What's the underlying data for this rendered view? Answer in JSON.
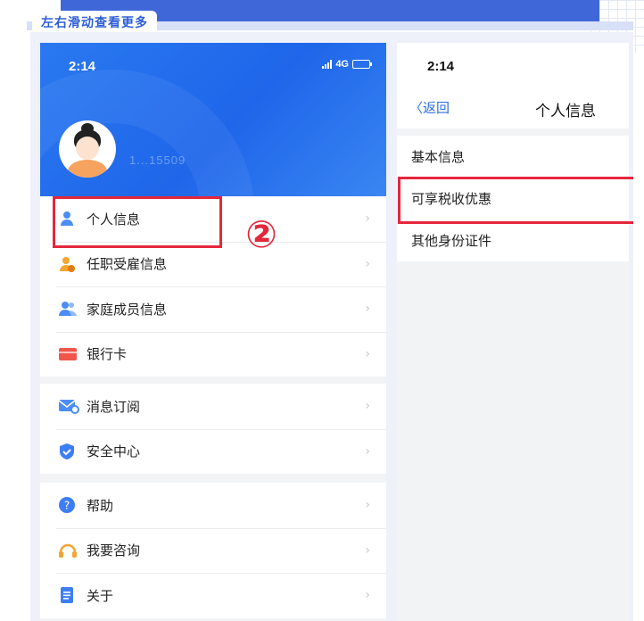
{
  "hint": "左右滑动查看更多",
  "left_screen": {
    "status": {
      "time": "2:14",
      "network": "4G"
    },
    "user_id_masked": "1...15509",
    "groups": [
      [
        {
          "label": "个人信息",
          "icon": "person-icon"
        },
        {
          "label": "任职受雇信息",
          "icon": "employee-icon"
        },
        {
          "label": "家庭成员信息",
          "icon": "family-icon"
        },
        {
          "label": "银行卡",
          "icon": "bank-card-icon"
        }
      ],
      [
        {
          "label": "消息订阅",
          "icon": "mail-icon"
        },
        {
          "label": "安全中心",
          "icon": "shield-icon"
        }
      ],
      [
        {
          "label": "帮助",
          "icon": "help-icon"
        },
        {
          "label": "我要咨询",
          "icon": "headset-icon"
        },
        {
          "label": "关于",
          "icon": "document-icon"
        }
      ]
    ],
    "arrow": "›"
  },
  "annotation": {
    "step": "②"
  },
  "right_screen": {
    "status": {
      "time": "2:14"
    },
    "back_label": "〈返回",
    "title": "个人信息",
    "items": [
      "基本信息",
      "可享税收优惠",
      "其他身份证件"
    ]
  },
  "colors": {
    "accent_blue": "#1f66ea",
    "highlight_red": "#e5273c"
  }
}
